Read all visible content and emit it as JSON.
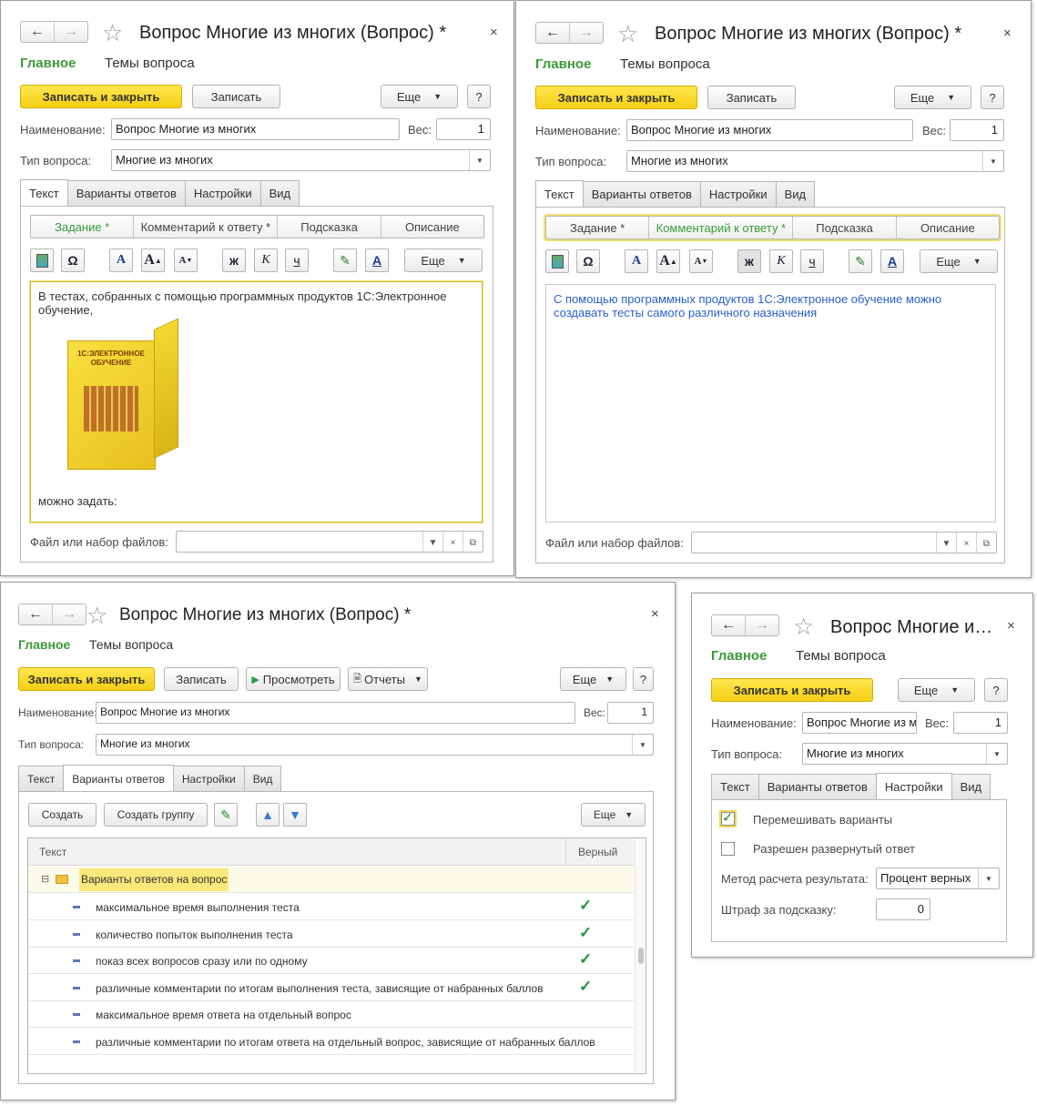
{
  "common": {
    "back_icon": "arrow-left",
    "forward_icon": "arrow-right",
    "star_icon": "star-outline",
    "close_icon": "close-x",
    "nav_main": "Главное",
    "nav_topics": "Темы вопроса",
    "save_close": "Записать и закрыть",
    "save": "Записать",
    "more": "Еще",
    "help": "?",
    "name_label": "Наименование:",
    "name_value": "Вопрос Многие из многих",
    "weight_label": "Вес:",
    "weight_value": "1",
    "type_label": "Тип вопроса:",
    "type_value": "Многие из многих",
    "tab_text": "Текст",
    "tab_variants": "Варианты ответов",
    "tab_settings": "Настройки",
    "tab_view": "Вид",
    "files_label": "Файл или набор файлов:",
    "files_value": "",
    "seg_task": "Задание *",
    "seg_comment": "Комментарий к ответу *",
    "seg_hint": "Подсказка",
    "seg_desc": "Описание"
  },
  "win1": {
    "title": "Вопрос Многие из многих (Вопрос) *",
    "text_before": "В тестах, собранных с помощью программных продуктов 1С:Электронное обучение,",
    "image_caption": "1С:ЭЛЕКТРОННОЕ ОБУЧЕНИЕ",
    "text_after": "можно задать:"
  },
  "win2": {
    "title": "Вопрос Многие из многих (Вопрос) *",
    "comment_text": "С помощью программных продуктов 1С:Электронное обучение можно создавать тесты самого различного назначения"
  },
  "win3": {
    "title": "Вопрос Многие из многих (Вопрос) *",
    "preview": "Просмотреть",
    "reports": "Отчеты",
    "create": "Создать",
    "create_group": "Создать группу",
    "col_text": "Текст",
    "col_correct": "Верный",
    "group_label": "Варианты ответов на вопрос",
    "rows": [
      {
        "text": "максимальное время выполнения теста",
        "correct": true
      },
      {
        "text": "количество попыток выполнения теста",
        "correct": true
      },
      {
        "text": "показ всех вопросов сразу или по одному",
        "correct": true
      },
      {
        "text": "различные комментарии по итогам выполнения теста, зависящие от набранных баллов",
        "correct": true
      },
      {
        "text": "максимальное время ответа на отдельный вопрос",
        "correct": false
      },
      {
        "text": "различные комментарии по итогам ответа на отдельный вопрос, зависящие от набранных баллов",
        "correct": false
      }
    ]
  },
  "win4": {
    "title": "Вопрос Многие из многих (Вопрос) *",
    "shuffle_label": "Перемешивать варианты",
    "shuffle_checked": true,
    "expanded_label": "Разрешен развернутый ответ",
    "expanded_checked": false,
    "method_label": "Метод расчета результата:",
    "method_value": "Процент верных",
    "penalty_label": "Штраф за подсказку:",
    "penalty_value": "0"
  },
  "colors": {
    "accent_green": "#3a9a3a",
    "button_yellow": "#f5cf15",
    "highlight_row": "#fbe77a",
    "check_green": "#1a9a3a",
    "comment_blue": "#2a5fd0"
  }
}
